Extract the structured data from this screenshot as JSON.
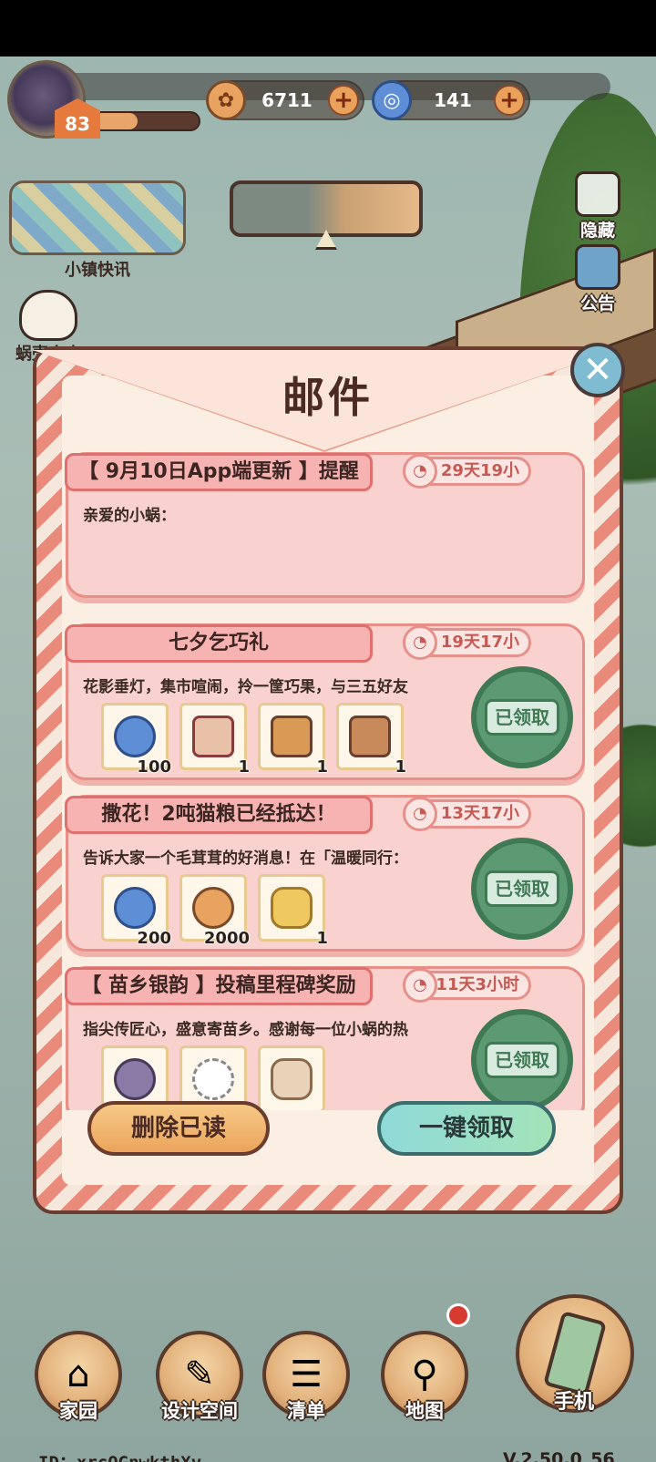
{
  "hud": {
    "level": "83",
    "xp_fraction": 0.42,
    "coins": "6711",
    "shells": "141"
  },
  "left": {
    "news_label": "小镇快讯",
    "shop_label": "蜗壳仓库"
  },
  "side": {
    "hide_label": "隐藏",
    "notice_label": "公告"
  },
  "mail": {
    "title": "邮件",
    "items": [
      {
        "title": "【 9月10日App端更新 】提醒",
        "timer": "29天19小",
        "body": "亲爱的小蜗：",
        "rewards": [],
        "claimed": ""
      },
      {
        "title": "七夕乞巧礼",
        "timer": "19天17小",
        "body": "花影垂灯，集市喧闹，拎一筐巧果，与三五好友",
        "rewards": [
          {
            "icon": "shell-currency-icon",
            "qty": "100"
          },
          {
            "icon": "ribbon-item-icon",
            "qty": "1"
          },
          {
            "icon": "qiaoguo-tray-icon",
            "qty": "1"
          },
          {
            "icon": "wood-plank-icon",
            "qty": "1"
          }
        ],
        "claimed": "已领取"
      },
      {
        "title": "撒花！2吨猫粮已经抵达！",
        "timer": "13天17小",
        "body": "告诉大家一个毛茸茸的好消息！在「温暖同行：",
        "rewards": [
          {
            "icon": "shell-currency-icon",
            "qty": "200"
          },
          {
            "icon": "coin-currency-icon",
            "qty": "2000"
          },
          {
            "icon": "gold-trophy-icon",
            "qty": "1"
          }
        ],
        "claimed": "已领取"
      },
      {
        "title": "【 苗乡银韵 】投稿里程碑奖励",
        "timer": "11天3小时",
        "body": "指尖传匠心，盛意寄苗乡。感谢每一位小蜗的热",
        "rewards": [
          {
            "icon": "avatar-frame-icon",
            "qty": ""
          },
          {
            "icon": "silver-necklace-icon",
            "qty": ""
          },
          {
            "icon": "hat-item-icon",
            "qty": ""
          }
        ],
        "claimed": "已领取"
      }
    ],
    "delete_label": "删除已读",
    "claim_all_label": "一键领取"
  },
  "nav": {
    "home": "家园",
    "design": "设计空间",
    "list": "清单",
    "map": "地图",
    "phone": "手机"
  },
  "footer": {
    "user_id": "ID：xrcQGnwkthXv",
    "version": "V.2.50.0_56"
  }
}
